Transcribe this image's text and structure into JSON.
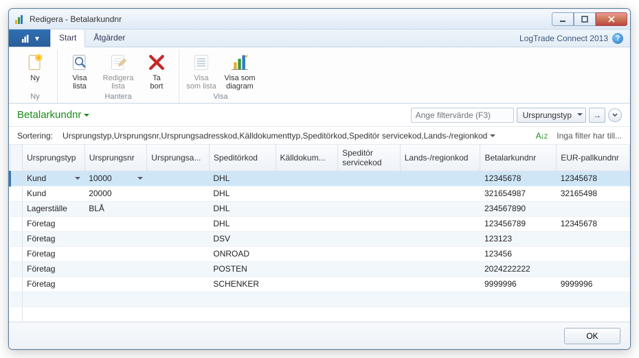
{
  "window": {
    "title": "Redigera - Betalarkundnr"
  },
  "ribbon": {
    "tabs": {
      "start": "Start",
      "actions": "Åtgärder"
    },
    "brand": "LogTrade Connect 2013",
    "groups": {
      "ny": {
        "title": "Ny",
        "buttons": {
          "ny": "Ny"
        }
      },
      "hantera": {
        "title": "Hantera",
        "buttons": {
          "visa_lista": "Visa\nlista",
          "redigera_lista": "Redigera\nlista",
          "ta_bort": "Ta\nbort"
        }
      },
      "visa": {
        "title": "Visa",
        "buttons": {
          "visa_som_lista": "Visa\nsom lista",
          "visa_som_diagram": "Visa som\ndiagram"
        }
      }
    }
  },
  "filterbar": {
    "view_title": "Betalarkundnr",
    "filter_placeholder": "Ange filtervärde (F3)",
    "filter_field": "Ursprungstyp"
  },
  "sortbar": {
    "label": "Sortering:",
    "keys": "Ursprungstyp,Ursprungsnr,Ursprungsadresskod,Källdokumenttyp,Speditörkod,Speditör servicekod,Lands-/regionkod",
    "no_filter": "Inga filter har till..."
  },
  "grid": {
    "columns": [
      "Ursprungstyp",
      "Ursprungsnr",
      "Ursprungsa...",
      "Speditörkod",
      "Källdokum...",
      "Speditör servicekod",
      "Lands-/regionkod",
      "Betalarkundnr",
      "EUR-pallkundnr"
    ],
    "rows": [
      {
        "Ursprungstyp": "Kund",
        "Ursprungsnr": "10000",
        "Speditörkod": "DHL",
        "Betalarkundnr": "12345678",
        "EUR-pallkundnr": "12345678"
      },
      {
        "Ursprungstyp": "Kund",
        "Ursprungsnr": "20000",
        "Speditörkod": "DHL",
        "Betalarkundnr": "321654987",
        "EUR-pallkundnr": "32165498"
      },
      {
        "Ursprungstyp": "Lagerställe",
        "Ursprungsnr": "BLÅ",
        "Speditörkod": "DHL",
        "Betalarkundnr": "234567890"
      },
      {
        "Ursprungstyp": "Företag",
        "Speditörkod": "DHL",
        "Betalarkundnr": "123456789",
        "EUR-pallkundnr": "12345678"
      },
      {
        "Ursprungstyp": "Företag",
        "Speditörkod": "DSV",
        "Betalarkundnr": "123123"
      },
      {
        "Ursprungstyp": "Företag",
        "Speditörkod": "ONROAD",
        "Betalarkundnr": "123456"
      },
      {
        "Ursprungstyp": "Företag",
        "Speditörkod": "POSTEN",
        "Betalarkundnr": "2024222222"
      },
      {
        "Ursprungstyp": "Företag",
        "Speditörkod": "SCHENKER",
        "Betalarkundnr": "9999996",
        "EUR-pallkundnr": "9999996"
      }
    ],
    "selected_index": 0
  },
  "okbar": {
    "ok": "OK"
  }
}
